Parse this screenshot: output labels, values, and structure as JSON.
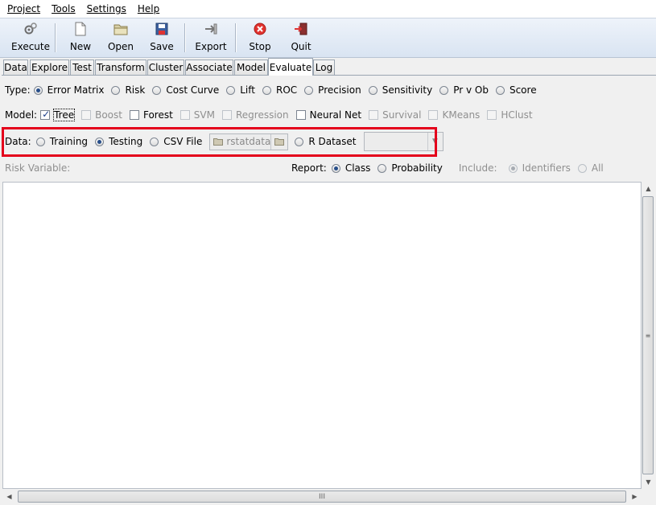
{
  "menu": [
    "Project",
    "Tools",
    "Settings",
    "Help"
  ],
  "toolbar": {
    "execute": "Execute",
    "new": "New",
    "open": "Open",
    "save": "Save",
    "export": "Export",
    "stop": "Stop",
    "quit": "Quit"
  },
  "tabs": [
    "Data",
    "Explore",
    "Test",
    "Transform",
    "Cluster",
    "Associate",
    "Model",
    "Evaluate",
    "Log"
  ],
  "active_tab": "Evaluate",
  "type": {
    "label": "Type:",
    "options": [
      "Error Matrix",
      "Risk",
      "Cost Curve",
      "Lift",
      "ROC",
      "Precision",
      "Sensitivity",
      "Pr v Ob",
      "Score"
    ],
    "selected": "Error Matrix"
  },
  "model": {
    "label": "Model:",
    "options": [
      "Tree",
      "Boost",
      "Forest",
      "SVM",
      "Regression",
      "Neural Net",
      "Survival",
      "KMeans",
      "HClust"
    ],
    "checked": [
      "Tree"
    ]
  },
  "data": {
    "label": "Data:",
    "options": [
      "Training",
      "Testing",
      "CSV File",
      "R Dataset"
    ],
    "selected": "Testing",
    "file_value": "rstatdata"
  },
  "risk_variable_label": "Risk Variable:",
  "report": {
    "label": "Report:",
    "options": [
      "Class",
      "Probability"
    ],
    "selected": "Class"
  },
  "include": {
    "label": "Include:",
    "options": [
      "Identifiers",
      "All"
    ],
    "selected": "Identifiers"
  },
  "scrollbar_grip": "≡",
  "hscroll_grip": "III"
}
